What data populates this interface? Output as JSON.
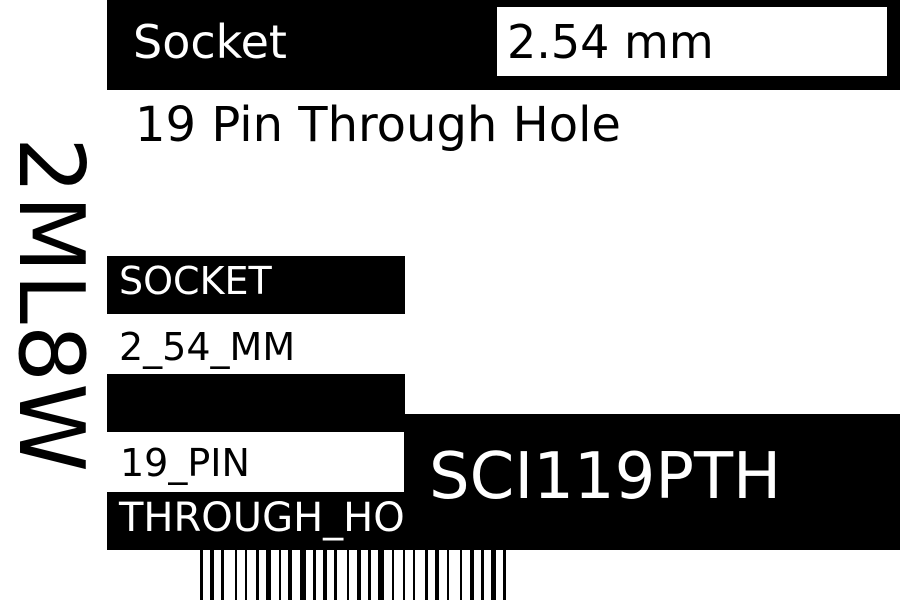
{
  "label": {
    "category": "Socket",
    "pitch": "2.54 mm",
    "description": "19 Pin Through Hole",
    "code_vertical": "2ML8W",
    "tags": {
      "category": "SOCKET",
      "pitch": "2_54_MM",
      "blank": "",
      "pins": "19_PIN",
      "mount": "THROUGH_HOLE"
    },
    "part_number": "SCI119PTH"
  },
  "colors": {
    "ink": "#000000",
    "paper": "#ffffff"
  }
}
